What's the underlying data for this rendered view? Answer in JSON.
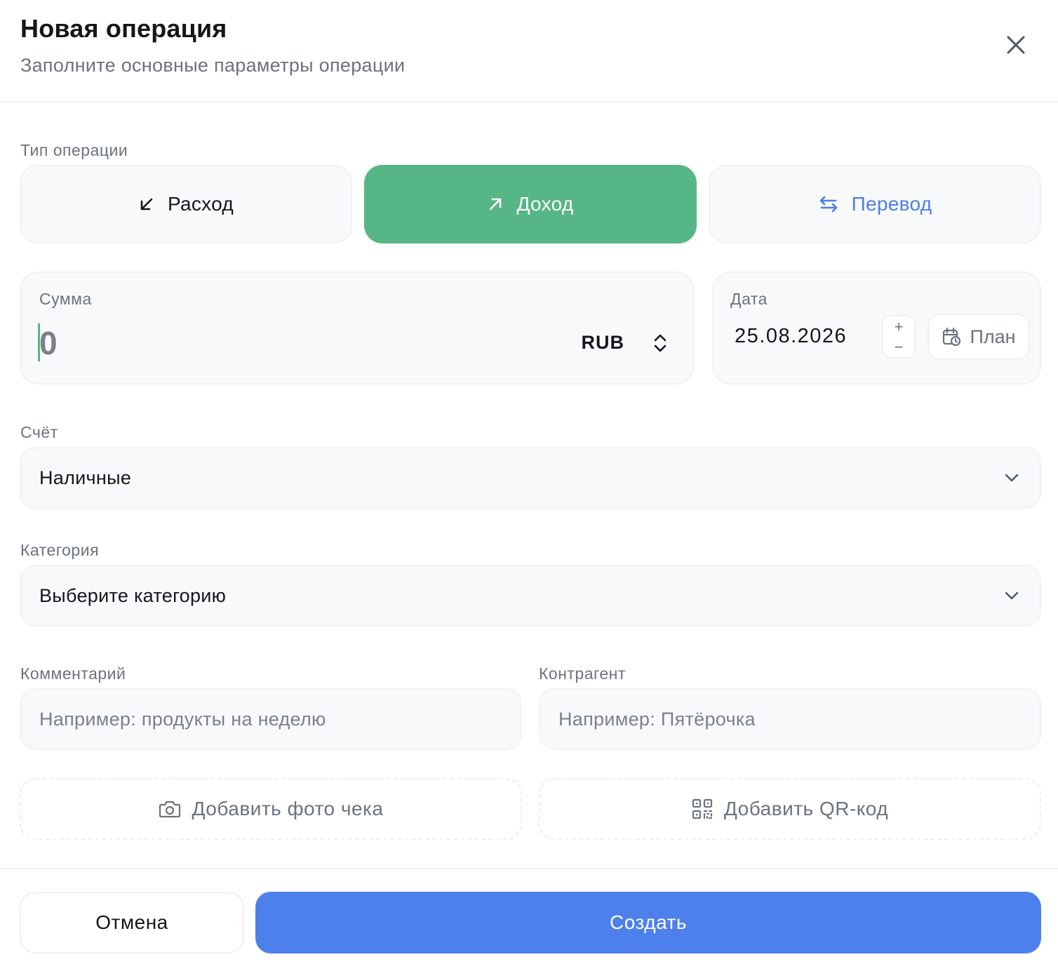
{
  "header": {
    "title": "Новая операция",
    "subtitle": "Заполните основные параметры операции"
  },
  "operation_type": {
    "label": "Тип операции",
    "options": [
      {
        "label": "Расход",
        "icon": "arrow-down-left-icon",
        "selected": false
      },
      {
        "label": "Доход",
        "icon": "arrow-up-right-icon",
        "selected": true
      },
      {
        "label": "Перевод",
        "icon": "arrows-swap-icon",
        "selected": false
      }
    ]
  },
  "amount": {
    "label": "Сумма",
    "value": "0",
    "currency": "RUB"
  },
  "date": {
    "label": "Дата",
    "value": "25.08.2026",
    "plus": "+",
    "minus": "−",
    "plan_label": "План"
  },
  "account": {
    "label": "Счёт",
    "value": "Наличные"
  },
  "category": {
    "label": "Категория",
    "value": "Выберите категорию"
  },
  "comment": {
    "label": "Комментарий",
    "placeholder": "Например: продукты на неделю"
  },
  "counterparty": {
    "label": "Контрагент",
    "placeholder": "Например: Пятёрочка"
  },
  "attachments": {
    "photo_label": "Добавить фото чека",
    "qr_label": "Добавить QR-код"
  },
  "footer": {
    "cancel_label": "Отмена",
    "create_label": "Создать"
  },
  "colors": {
    "income_green": "#57b685",
    "primary_blue": "#4d80eb",
    "transfer_blue": "#4c7ee8",
    "muted_text": "#6b7280"
  }
}
